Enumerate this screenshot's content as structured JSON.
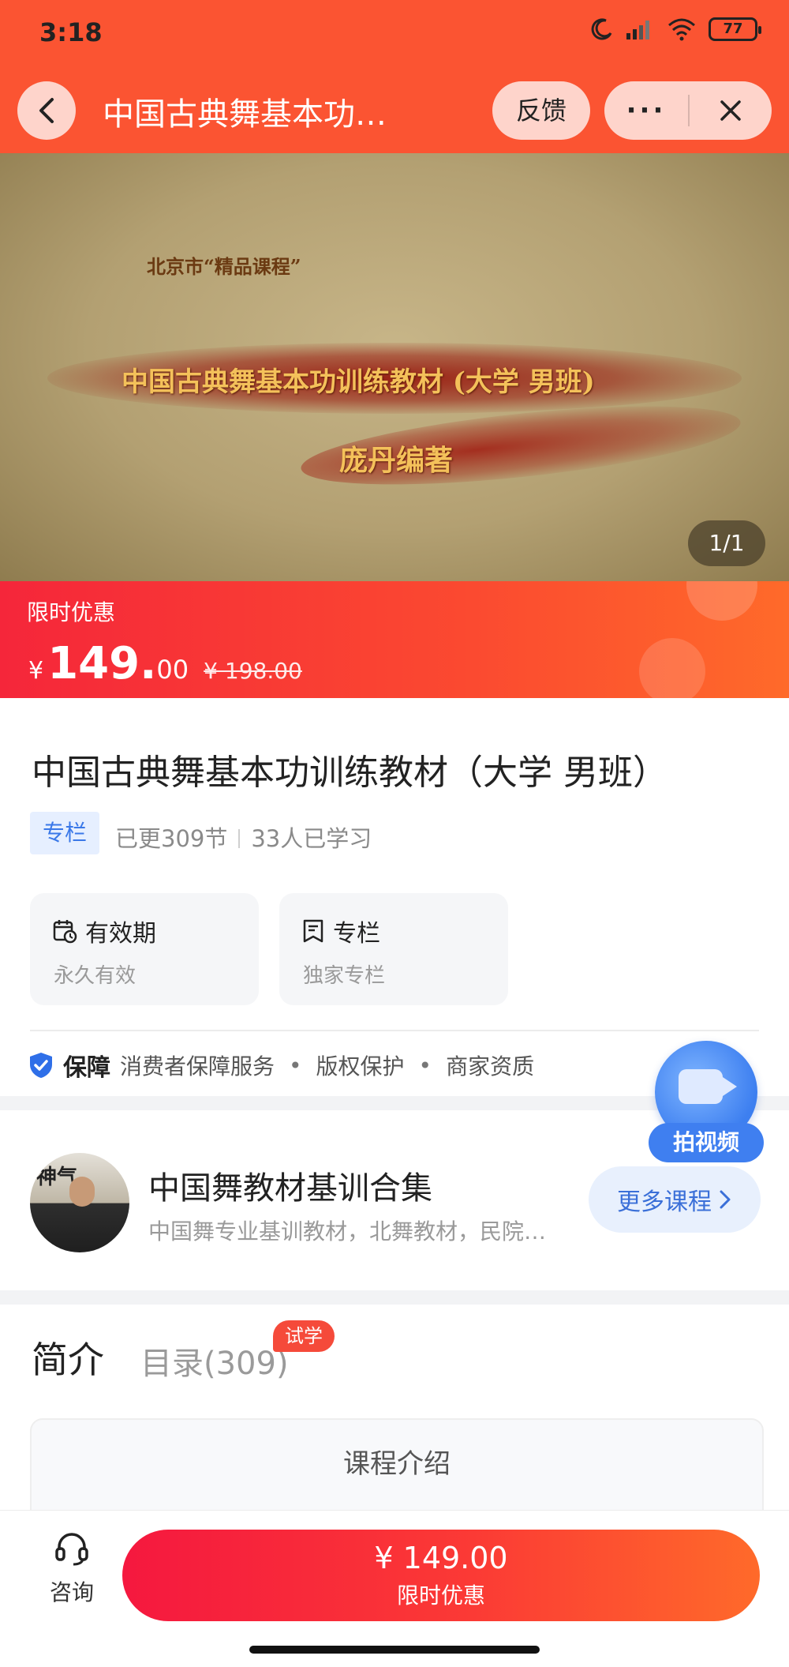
{
  "status_bar": {
    "time": "3:18",
    "battery": "77"
  },
  "nav": {
    "title": "中国古典舞基本功…",
    "feedback_label": "反馈",
    "more_label": "···"
  },
  "hero": {
    "small_text": "北京市“精品课程”",
    "title": "中国古典舞基本功训练教材 (大学  男班)",
    "author": "庞丹编著",
    "counter": "1/1"
  },
  "price": {
    "tag": "限时优惠",
    "currency": "¥",
    "integer": "149.",
    "decimal": "00",
    "original": "¥ 198.00"
  },
  "course": {
    "title": "中国古典舞基本功训练教材（大学 男班）",
    "type_tag": "专栏",
    "updated": "已更309节",
    "learners": "33人已学习",
    "validity_title": "有效期",
    "validity_value": "永久有效",
    "column_title": "专栏",
    "column_value": "独家专栏",
    "guarantee_label": "保障",
    "guarantee_items": [
      "消费者保障服务",
      "版权保护",
      "商家资质"
    ]
  },
  "author": {
    "name": "中国舞教材基训合集",
    "description": "中国舞专业基训教材，北舞教材，民院…",
    "more_label": "更多课程",
    "avatar_text": "神气"
  },
  "float_video": {
    "label": "拍视频"
  },
  "tabs": {
    "intro_label": "简介",
    "catalog_label": "目录(309)",
    "trial_badge": "试学",
    "intro_header": "课程介绍"
  },
  "bottom": {
    "consult_label": "咨询",
    "buy_price": "¥ 149.00",
    "buy_label": "限时优惠"
  },
  "colors": {
    "brand_orange": "#fb5432",
    "price_red": "#f5263a",
    "link_blue": "#3a6fd8"
  }
}
